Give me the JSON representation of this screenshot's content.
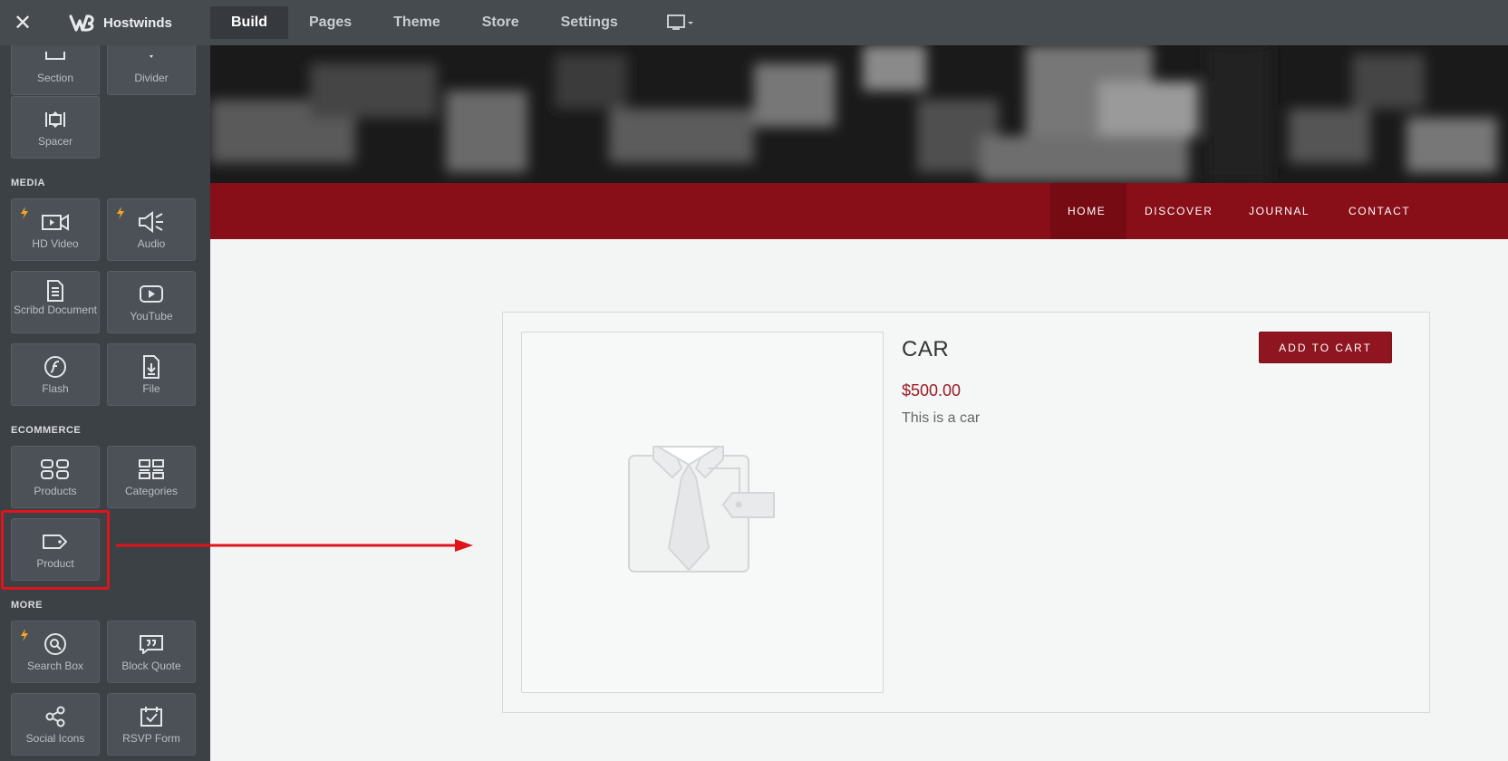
{
  "topbar": {
    "brand": "Hostwinds",
    "tabs": [
      {
        "label": "Build",
        "active": true
      },
      {
        "label": "Pages",
        "active": false
      },
      {
        "label": "Theme",
        "active": false
      },
      {
        "label": "Store",
        "active": false
      },
      {
        "label": "Settings",
        "active": false
      }
    ]
  },
  "sidebar": {
    "tiles_top": [
      {
        "label": "Section",
        "icon": "section-icon"
      },
      {
        "label": "Divider",
        "icon": "divider-icon"
      },
      {
        "label": "Spacer",
        "icon": "spacer-icon"
      }
    ],
    "media": {
      "heading": "MEDIA",
      "tiles": [
        {
          "label": "HD Video",
          "icon": "video-camera-icon"
        },
        {
          "label": "Audio",
          "icon": "speaker-icon"
        },
        {
          "label": "Scribd Document",
          "icon": "document-icon"
        },
        {
          "label": "YouTube",
          "icon": "youtube-play-icon"
        },
        {
          "label": "Flash",
          "icon": "flash-icon"
        },
        {
          "label": "File",
          "icon": "file-download-icon"
        }
      ]
    },
    "ecommerce": {
      "heading": "ECOMMERCE",
      "tiles": [
        {
          "label": "Products",
          "icon": "products-grid-icon"
        },
        {
          "label": "Categories",
          "icon": "categories-grid-icon"
        },
        {
          "label": "Product",
          "icon": "tag-icon"
        }
      ]
    },
    "more": {
      "heading": "MORE",
      "tiles": [
        {
          "label": "Search Box",
          "icon": "search-icon"
        },
        {
          "label": "Block Quote",
          "icon": "quote-icon"
        },
        {
          "label": "Social Icons",
          "icon": "share-icon"
        },
        {
          "label": "RSVP Form",
          "icon": "rsvp-calendar-icon"
        }
      ]
    },
    "accent_color": "#f5a623",
    "highlight_color": "#e0141b"
  },
  "site": {
    "nav": [
      "HOME",
      "DISCOVER",
      "JOURNAL",
      "CONTACT"
    ],
    "nav_color": "#880e17",
    "product": {
      "title": "CAR",
      "price": "$500.00",
      "description": "This is a car",
      "button": "ADD TO CART"
    }
  }
}
